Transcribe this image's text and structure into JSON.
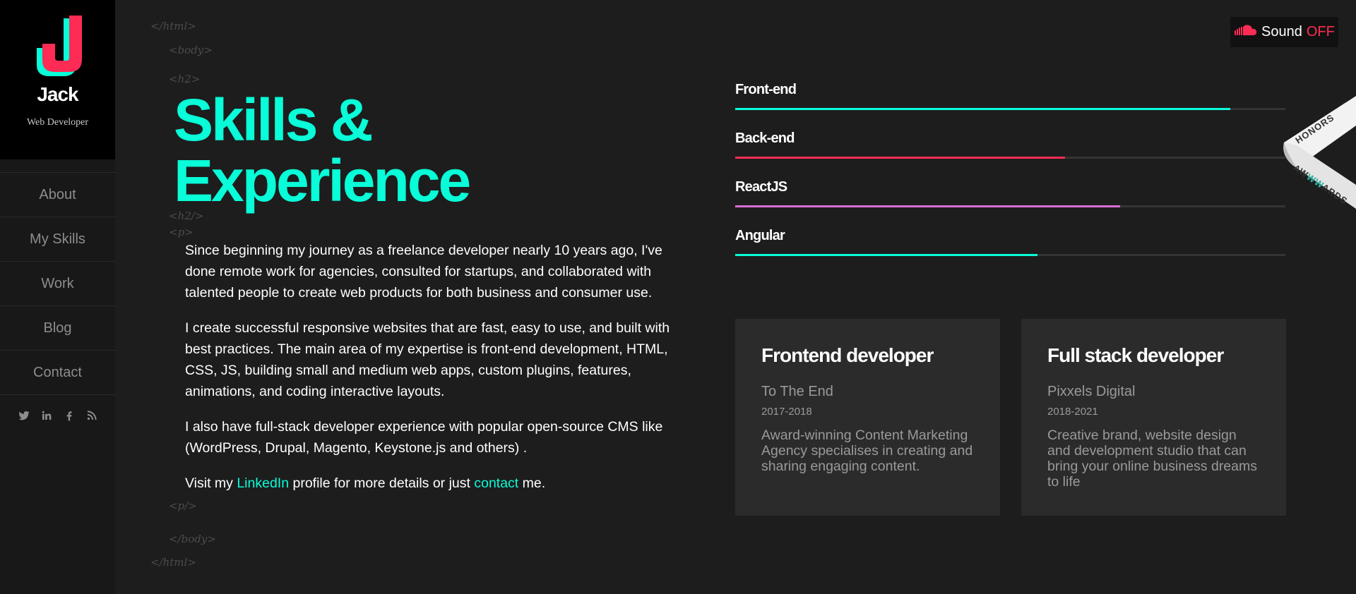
{
  "brand": {
    "logo_letter": "J",
    "name": "Jack",
    "title": "Web Developer",
    "color_primary": "#08fdd8",
    "color_secondary": "#fe2c55"
  },
  "nav": {
    "items": [
      {
        "label": "About"
      },
      {
        "label": "My Skills"
      },
      {
        "label": "Work"
      },
      {
        "label": "Blog"
      },
      {
        "label": "Contact"
      }
    ],
    "socials": [
      "twitter-icon",
      "linkedin-icon",
      "facebook-icon",
      "rss-icon"
    ]
  },
  "code_tags": {
    "html_open": "</html>",
    "body_open": "<body>",
    "h2_open": "<h2>",
    "h2_close": "<h2/>",
    "p_open": "<p>",
    "p_close": "<p/>",
    "body_close": "</body>",
    "html_close": "</html>"
  },
  "heading": {
    "line1": "Skills &",
    "line2": "Experience"
  },
  "intro": {
    "p1": "Since beginning my journey as a freelance developer nearly 10 years ago, I've done remote work for agencies, consulted for startups, and collaborated with talented people to create web products for both business and consumer use.",
    "p2": "I create successful responsive websites that are fast, easy to use, and built with best practices. The main area of my expertise is front-end development, HTML, CSS, JS, building small and medium web apps, custom plugins, features, animations, and coding interactive layouts.",
    "p3": "I also have full-stack developer experience with popular open-source CMS like (WordPress, Drupal, Magento, Keystone.js and others) .",
    "p4_before": "Visit my ",
    "p4_link1": "LinkedIn",
    "p4_middle": " profile for more details or just ",
    "p4_link2": "contact",
    "p4_after": " me."
  },
  "skills": [
    {
      "name": "Front-end",
      "level": 0.9,
      "color": "#08fdd8"
    },
    {
      "name": "Back-end",
      "level": 0.6,
      "color": "#fe2c55"
    },
    {
      "name": "ReactJS",
      "level": 0.7,
      "color": "#dd6ed7"
    },
    {
      "name": "Angular",
      "level": 0.55,
      "color": "#08fdd8"
    }
  ],
  "experience": [
    {
      "role": "Frontend developer",
      "company": "To The End",
      "dates": "2017-2018",
      "description": "Award-winning Content Marketing Agency specialises in creating and sharing engaging content."
    },
    {
      "role": "Full stack developer",
      "company": "Pixxels Digital",
      "dates": "2018-2021",
      "description": "Creative brand, website design and development studio that can bring your online business dreams to life"
    }
  ],
  "sound": {
    "label": "Sound",
    "state": "OFF"
  },
  "ribbon": {
    "top": "HONORS",
    "bottom_a": "AW",
    "bottom_b": "WW",
    "bottom_c": "ARDS"
  }
}
